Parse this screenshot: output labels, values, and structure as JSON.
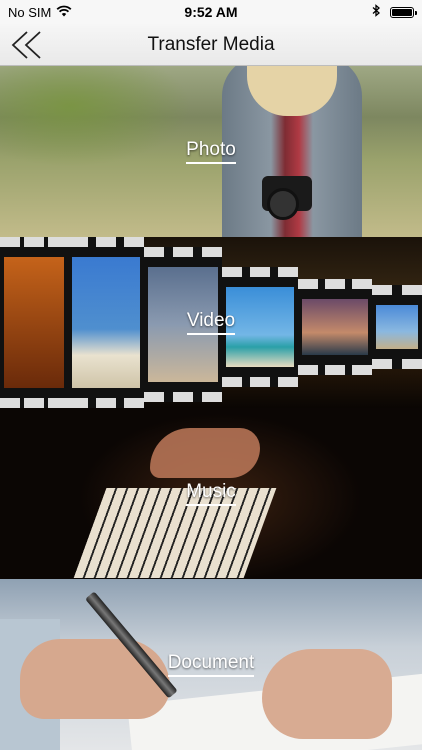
{
  "status_bar": {
    "carrier": "No SIM",
    "time": "9:52 AM",
    "battery_level": 1.0,
    "icons": [
      "wifi-icon",
      "bluetooth-icon",
      "battery-icon"
    ]
  },
  "nav": {
    "title": "Transfer Media",
    "back_icon": "double-chevron-left-icon"
  },
  "tiles": [
    {
      "id": "photo",
      "label": "Photo"
    },
    {
      "id": "video",
      "label": "Video"
    },
    {
      "id": "music",
      "label": "Music"
    },
    {
      "id": "document",
      "label": "Document"
    }
  ]
}
